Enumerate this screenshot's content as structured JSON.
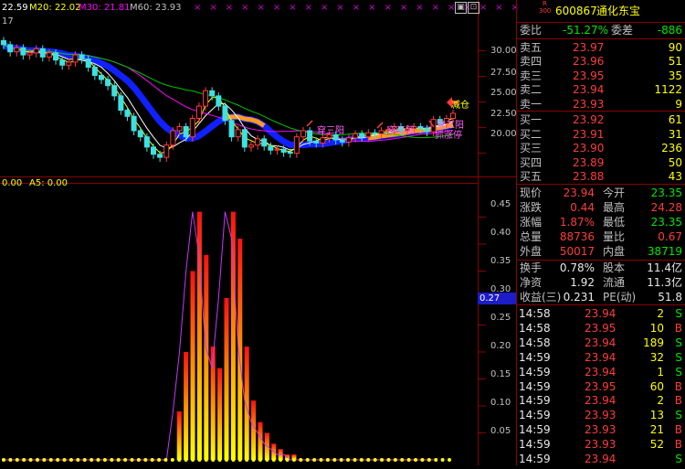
{
  "header": {
    "ma_fragment": "22.59",
    "m20": "M20: 22.02",
    "m30": "M30: 21.81",
    "m60": "M60: 23.93",
    "left_fragment": "17",
    "sub_fragment": "0.00",
    "a5": "A5: 0.00"
  },
  "price_axis": [
    "30.00",
    "27.50",
    "25.00",
    "22.50",
    "20.00"
  ],
  "indicator_axis": [
    "0.45",
    "0.40",
    "0.35",
    "0.30",
    "0.25",
    "0.20",
    "0.15",
    "0.10",
    "0.05"
  ],
  "cursor_value": "0.27",
  "annotations": {
    "jiancang": "减仓",
    "chuansanyang_1": "穿三阳",
    "chuansanyang_2": "穿三阳",
    "chuansanyang_3": "穿三阳",
    "zhuangzhangting": "抓涨停"
  },
  "stock": {
    "badge_top": "R",
    "badge_bottom": "300",
    "code": "600867",
    "name": "通化东宝"
  },
  "order_book": {
    "weibi_label": "委比",
    "weibi_value": "-51.27%",
    "weicha_label": "委差",
    "weicha_value": "-886",
    "asks": [
      {
        "label": "卖五",
        "price": "23.97",
        "vol": "90"
      },
      {
        "label": "卖四",
        "price": "23.96",
        "vol": "51"
      },
      {
        "label": "卖三",
        "price": "23.95",
        "vol": "35"
      },
      {
        "label": "卖二",
        "price": "23.94",
        "vol": "1122"
      },
      {
        "label": "卖一",
        "price": "23.93",
        "vol": "9"
      }
    ],
    "bids": [
      {
        "label": "买一",
        "price": "23.92",
        "vol": "61"
      },
      {
        "label": "买二",
        "price": "23.91",
        "vol": "31"
      },
      {
        "label": "买三",
        "price": "23.90",
        "vol": "236"
      },
      {
        "label": "买四",
        "price": "23.89",
        "vol": "50"
      },
      {
        "label": "买五",
        "price": "23.88",
        "vol": "43"
      }
    ]
  },
  "quote": {
    "rows": [
      {
        "l1": "现价",
        "v1": "23.94",
        "l2": "今开",
        "v2": "23.35"
      },
      {
        "l1": "涨跌",
        "v1": "0.44",
        "l2": "最高",
        "v2": "24.28"
      },
      {
        "l1": "涨幅",
        "v1": "1.87%",
        "l2": "最低",
        "v2": "23.35"
      },
      {
        "l1": "总量",
        "v1": "88736",
        "l2": "量比",
        "v2": "0.67"
      },
      {
        "l1": "外盘",
        "v1": "50017",
        "l2": "内盘",
        "v2": "38719"
      }
    ],
    "rows2": [
      {
        "l1": "换手",
        "v1": "0.78%",
        "l2": "股本",
        "v2": "11.4亿"
      },
      {
        "l1": "净资",
        "v1": "1.92",
        "l2": "流通",
        "v2": "11.3亿"
      },
      {
        "l1": "收益(三)",
        "v1": "0.231",
        "l2": "PE(动)",
        "v2": "51.8"
      }
    ]
  },
  "ticks": [
    {
      "time": "14:58",
      "price": "23.94",
      "vol": "2",
      "side": "S"
    },
    {
      "time": "14:58",
      "price": "23.95",
      "vol": "10",
      "side": "B"
    },
    {
      "time": "14:58",
      "price": "23.94",
      "vol": "189",
      "side": "S"
    },
    {
      "time": "14:59",
      "price": "23.94",
      "vol": "32",
      "side": "S"
    },
    {
      "time": "14:59",
      "price": "23.94",
      "vol": "1",
      "side": "S"
    },
    {
      "time": "14:59",
      "price": "23.95",
      "vol": "60",
      "side": "B"
    },
    {
      "time": "14:59",
      "price": "23.94",
      "vol": "2",
      "side": "B"
    },
    {
      "time": "14:59",
      "price": "23.93",
      "vol": "13",
      "side": "S"
    },
    {
      "time": "14:59",
      "price": "23.93",
      "vol": "21",
      "side": "B"
    },
    {
      "time": "14:59",
      "price": "23.93",
      "vol": "52",
      "side": "B"
    },
    {
      "time": "14:59",
      "price": "23.94",
      "vol": "",
      "side": "S"
    }
  ],
  "colors": {
    "up": "#ff3b3b",
    "down": "#00e600",
    "accent": "#ffff00",
    "ma5": "#ffffff",
    "ma10": "#ffff00",
    "ma20": "#ff00ff",
    "ma60": "#00c000",
    "band_blue": "#1020ff",
    "band_orange": "#ff9a20"
  },
  "chart_data": {
    "type": "line",
    "candles_close": [
      30.6,
      29.9,
      30.3,
      29.6,
      29.8,
      30.2,
      29.4,
      29.8,
      29.1,
      28.6,
      28.9,
      29.6,
      29.2,
      28.4,
      27.6,
      27.2,
      26.6,
      25.6,
      24.2,
      23.6,
      22.2,
      21.6,
      20.6,
      19.9,
      19.6,
      20.8,
      22.2,
      22.6,
      21.6,
      23.4,
      24.6,
      26.1,
      25.6,
      24.6,
      23.2,
      21.6,
      22.3,
      20.6,
      20.8,
      21.4,
      20.7,
      20.3,
      20.4,
      20.1,
      20.0,
      21.6,
      22.2,
      21.2,
      21.0,
      21.5,
      21.8,
      21.3,
      21.1,
      21.5,
      21.9,
      21.6,
      22.0,
      21.9,
      22.2,
      22.3,
      22.6,
      22.2,
      22.4,
      22.6,
      22.4,
      22.1,
      23.3,
      22.9,
      23.4,
      23.9
    ],
    "indicator": [
      0,
      0,
      0,
      0,
      0,
      0,
      0,
      0,
      0,
      0,
      0,
      0,
      0,
      0,
      0,
      0,
      0,
      0,
      0,
      0,
      0,
      0,
      0,
      0,
      0,
      0,
      0.09,
      0.2,
      0.35,
      0.46,
      0.38,
      0.21,
      0.17,
      0.3,
      0.46,
      0.41,
      0.21,
      0.11,
      0.07,
      0.05,
      0.03,
      0.02,
      0.01,
      0.01,
      0,
      0,
      0,
      0,
      0,
      0,
      0,
      0,
      0,
      0,
      0,
      0,
      0,
      0,
      0,
      0,
      0,
      0,
      0,
      0,
      0,
      0,
      0
    ],
    "price_ylim": [
      18.0,
      33.0
    ],
    "indicator_ylim": [
      0,
      0.5
    ]
  }
}
